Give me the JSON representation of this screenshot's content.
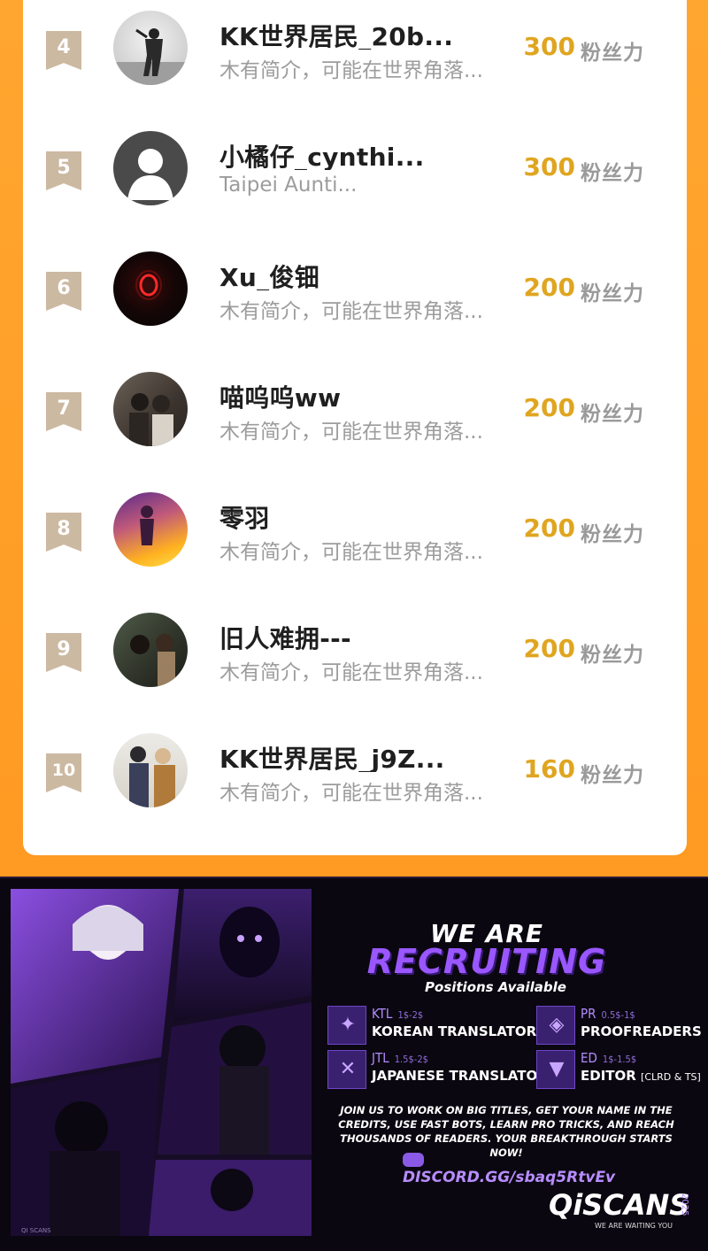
{
  "ranking": [
    {
      "rank": "4",
      "name": "KK世界居民_20b...",
      "bio": "木有简介，可能在世界角落...",
      "fans": "300",
      "fans_label": "粉丝力"
    },
    {
      "rank": "5",
      "name": "小橘仔_cynthi...",
      "bio": "Taipei Aunti...",
      "fans": "300",
      "fans_label": "粉丝力"
    },
    {
      "rank": "6",
      "name": "Xu_俊钿",
      "bio": "木有简介，可能在世界角落...",
      "fans": "200",
      "fans_label": "粉丝力"
    },
    {
      "rank": "7",
      "name": "喵呜呜ww",
      "bio": "木有简介，可能在世界角落...",
      "fans": "200",
      "fans_label": "粉丝力"
    },
    {
      "rank": "8",
      "name": "零羽",
      "bio": "木有简介，可能在世界角落...",
      "fans": "200",
      "fans_label": "粉丝力"
    },
    {
      "rank": "9",
      "name": "旧人难拥---",
      "bio": "木有简介，可能在世界角落...",
      "fans": "200",
      "fans_label": "粉丝力"
    },
    {
      "rank": "10",
      "name": "KK世界居民_j9Z...",
      "bio": "木有简介，可能在世界角落...",
      "fans": "160",
      "fans_label": "粉丝力"
    }
  ],
  "banner": {
    "title_1": "WE ARE",
    "title_2": "RECRUITING",
    "subtitle": "Positions Available",
    "positions": [
      {
        "abbr": "KTL",
        "rate": "1$-2$",
        "name": "KOREAN TRANSLATORS",
        "extra": "",
        "icon": "korean-translator-icon"
      },
      {
        "abbr": "PR",
        "rate": "0.5$-1$",
        "name": "PROOFREADERS",
        "extra": "",
        "icon": "proofreader-icon"
      },
      {
        "abbr": "JTL",
        "rate": "1.5$-2$",
        "name": "JAPANESE TRANSLATORS",
        "extra": "",
        "icon": "japanese-translator-icon"
      },
      {
        "abbr": "ED",
        "rate": "1$-1.5$",
        "name": "EDITOR",
        "extra": "[CLRD & TS]",
        "icon": "editor-icon"
      }
    ],
    "description": "JOIN US TO WORK ON BIG TITLES, GET YOUR NAME IN THE CREDITS, USE FAST BOTS, LEARN PRO TRICKS, AND REACH THOUSANDS OF READERS. YOUR BREAKTHROUGH STARTS NOW!",
    "discord": "DISCORD.GG/sbaq5RtvEv",
    "brand": "QiSCANS",
    "brand_tagline": "WE ARE WAITING YOU",
    "brand_year": "2025",
    "credit": "QI SCANS"
  },
  "colors": {
    "page_orange": "#ff9a22",
    "rank_badge": "#ccb9a2",
    "fans_gold": "#e0a520",
    "banner_purple": "#9a57ff"
  }
}
